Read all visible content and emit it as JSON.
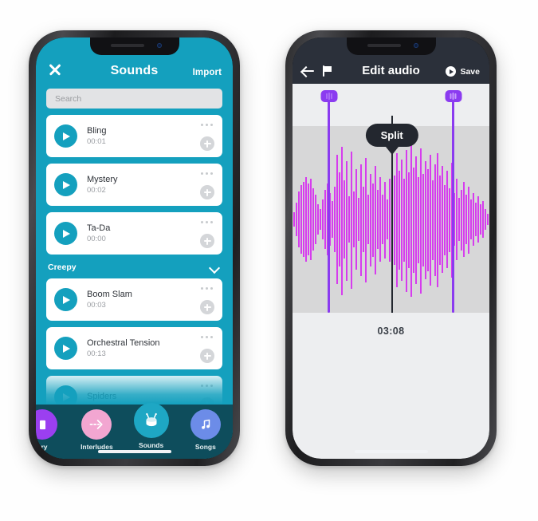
{
  "left_phone": {
    "app": "Sounds",
    "header": {
      "close_icon": "close-x-icon",
      "title": "Sounds",
      "import_label": "Import"
    },
    "search": {
      "placeholder": "Search",
      "value": ""
    },
    "sections": [
      {
        "label": null,
        "items": [
          {
            "name": "Bling",
            "duration": "00:01"
          },
          {
            "name": "Mystery",
            "duration": "00:02"
          },
          {
            "name": "Ta-Da",
            "duration": "00:00"
          }
        ]
      },
      {
        "label": "Creepy",
        "collapsed": false,
        "items": [
          {
            "name": "Boom Slam",
            "duration": "00:03"
          },
          {
            "name": "Orchestral Tension",
            "duration": "00:13"
          },
          {
            "name": "Spiders",
            "duration": ""
          }
        ]
      }
    ],
    "tabbar": [
      {
        "label": "ary",
        "icon": "library-icon",
        "color": "#9b3ff0",
        "active": false
      },
      {
        "label": "Interludes",
        "icon": "arrow-right-icon",
        "color": "#f2a6d1",
        "active": false
      },
      {
        "label": "Sounds",
        "icon": "drum-icon",
        "color": "#1ea7c4",
        "active": true
      },
      {
        "label": "Songs",
        "icon": "music-note-icon",
        "color": "#6c8ce8",
        "active": false
      }
    ],
    "colors": {
      "brand": "#14A0BE",
      "tabbar": "#0e4d5c"
    }
  },
  "right_phone": {
    "app": "Edit audio",
    "header": {
      "back_icon": "arrow-left-icon",
      "flag_icon": "flag-icon",
      "title": "Edit audio",
      "save_icon": "play-circle-icon",
      "save_label": "Save"
    },
    "editor": {
      "split_label": "Split",
      "timestamp": "03:08",
      "left_handle_icon": "selection-handle-icon",
      "right_handle_icon": "selection-handle-icon",
      "waveform_color": "#d63cee",
      "selection_color": "#8b3bf0",
      "split_color": "#23272f",
      "selection_start_pct": 18,
      "selection_end_pct": 81,
      "split_position_pct": 50
    }
  }
}
